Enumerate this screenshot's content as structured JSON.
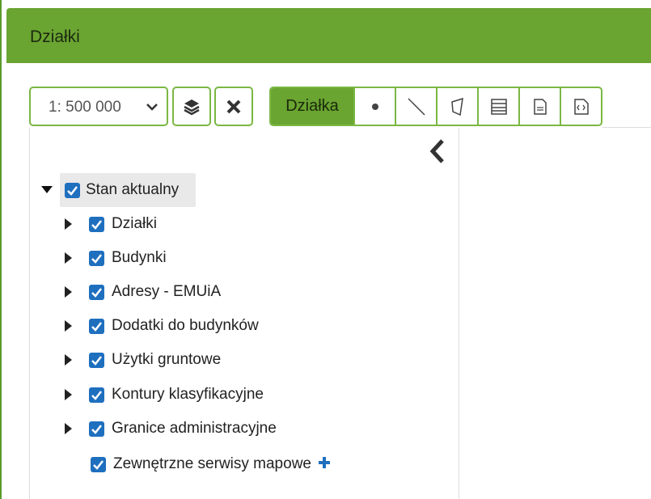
{
  "header": {
    "title": "Działki"
  },
  "toolbar": {
    "scale": {
      "value": "1: 500 000"
    },
    "layers_button": "layers-icon",
    "clear_button": "close-icon",
    "tools": {
      "active_label": "Działka",
      "items": [
        "point-icon",
        "line-icon",
        "polygon-icon",
        "table-icon",
        "document-icon",
        "export-icon"
      ]
    }
  },
  "tree": {
    "root": {
      "label": "Stan aktualny",
      "checked": true,
      "expanded": true
    },
    "children": [
      {
        "label": "Działki",
        "checked": true
      },
      {
        "label": "Budynki",
        "checked": true
      },
      {
        "label": "Adresy - EMUiA",
        "checked": true
      },
      {
        "label": "Dodatki do budynków",
        "checked": true
      },
      {
        "label": "Użytki gruntowe",
        "checked": true
      },
      {
        "label": "Kontury klasyfikacyjne",
        "checked": true
      },
      {
        "label": "Granice administracyjne",
        "checked": true
      }
    ],
    "external": {
      "label": "Zewnętrzne serwisy mapowe",
      "checked": true
    }
  },
  "colors": {
    "header": "#6aa431",
    "border": "#7bb743",
    "checkbox": "#1f6fbf"
  }
}
